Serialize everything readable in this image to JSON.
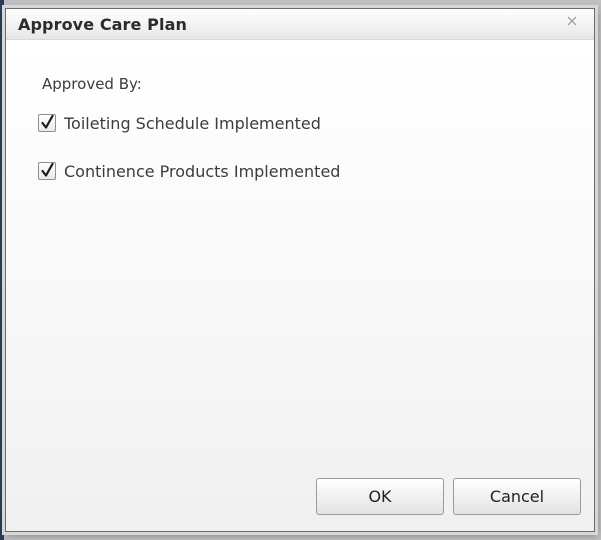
{
  "dialog": {
    "title": "Approve Care Plan",
    "close_icon": "close-icon",
    "approved_by_label": "Approved By:",
    "checkboxes": [
      {
        "label": "Toileting Schedule Implemented",
        "checked": true
      },
      {
        "label": "Continence Products Implemented",
        "checked": true
      }
    ],
    "buttons": {
      "ok_label": "OK",
      "cancel_label": "Cancel"
    }
  }
}
